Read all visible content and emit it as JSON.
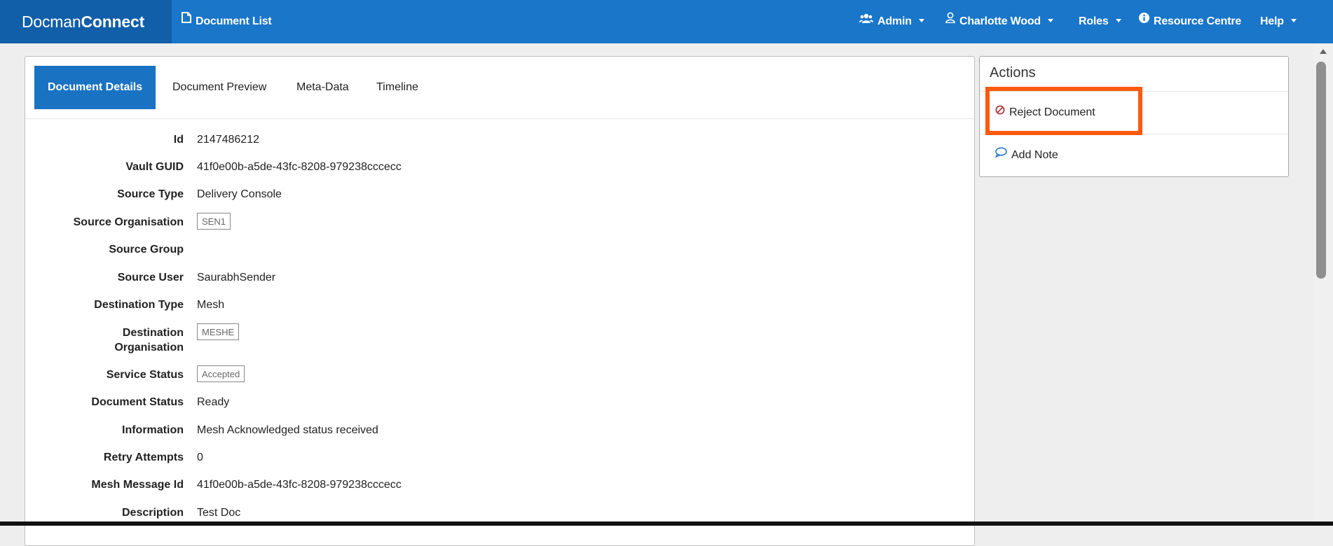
{
  "navbar": {
    "brand_plain": "Docman",
    "brand_bold": "Connect",
    "document_list": "Document List",
    "admin": "Admin",
    "user": "Charlotte Wood",
    "roles": "Roles",
    "resource_centre": "Resource Centre",
    "help": "Help"
  },
  "tabs": {
    "details": "Document Details",
    "preview": "Document Preview",
    "metadata": "Meta-Data",
    "timeline": "Timeline"
  },
  "details": {
    "id_label": "Id",
    "id_value": "2147486212",
    "vault_label": "Vault GUID",
    "vault_value": "41f0e00b-a5de-43fc-8208-979238cccecc",
    "source_type_label": "Source Type",
    "source_type_value": "Delivery Console",
    "source_org_label": "Source Organisation",
    "source_org_value": "SEN1",
    "source_group_label": "Source Group",
    "source_user_label": "Source User",
    "source_user_value": "SaurabhSender",
    "dest_type_label": "Destination Type",
    "dest_type_value": "Mesh",
    "dest_org_label_1": "Destination",
    "dest_org_label_2": "Organisation",
    "dest_org_value": "MESHE",
    "service_status_label": "Service Status",
    "service_status_value": "Accepted",
    "doc_status_label": "Document Status",
    "doc_status_value": "Ready",
    "information_label": "Information",
    "information_value": "Mesh Acknowledged status received",
    "retry_label": "Retry Attempts",
    "retry_value": "0",
    "mesh_id_label": "Mesh Message Id",
    "mesh_id_value": "41f0e00b-a5de-43fc-8208-979238cccecc",
    "description_label": "Description",
    "description_value": "Test Doc"
  },
  "actions": {
    "title": "Actions",
    "reject": "Reject Document",
    "add_note": "Add Note"
  },
  "colors": {
    "navbar": "#1976c9",
    "brand_bg": "#115ea9",
    "active_tab": "#1a73c2",
    "highlight": "#ff5a10",
    "reject_icon": "#b03a3a",
    "note_icon": "#1976c9"
  }
}
